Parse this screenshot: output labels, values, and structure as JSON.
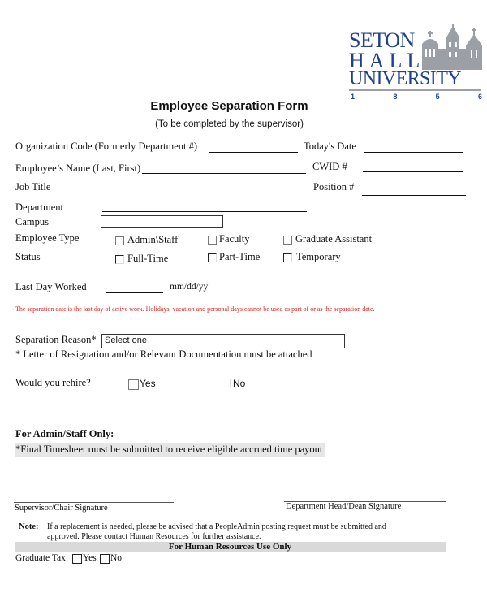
{
  "logo": {
    "line1": "SETON",
    "line2": "HALL",
    "line3": "UNIVERSITY",
    "years": [
      "1",
      "8",
      "5",
      "6"
    ],
    "color": "#1f3f8f"
  },
  "header": {
    "title": "Employee Separation Form",
    "subtitle": "(To be completed by the supervisor)"
  },
  "fields": {
    "org_code_label": "Organization Code (Formerly Department #)",
    "todays_date_label": "Today's Date",
    "employee_name_label": "Employee’s Name (Last, First)",
    "cwid_label": "CWID #",
    "job_title_label": "Job Title",
    "position_label": "Position #",
    "department_label": "Department",
    "campus_label": "Campus",
    "campus_value": "",
    "employee_type_label": "Employee Type",
    "status_label": "Status",
    "last_day_label": "Last Day Worked",
    "last_day_format": "mm/dd/yy"
  },
  "employee_type_options": [
    {
      "label": "Admin\\Staff",
      "checked": false
    },
    {
      "label": "Faculty",
      "checked": false
    },
    {
      "label": "Graduate Assistant",
      "checked": false
    }
  ],
  "status_options": [
    {
      "label": "Full-Time",
      "checked": false
    },
    {
      "label": "Part-Time",
      "checked": false
    },
    {
      "label": "Temporary",
      "checked": false
    }
  ],
  "separation_note": "The separation date is the last day of active work. Holidays, vacation and personal days cannot be used as part of or as the separation date.",
  "separation_reason": {
    "label": "Separation Reason*",
    "selected": "Select one",
    "footnote": "* Letter of Resignation and/or Relevant Documentation must be attached"
  },
  "rehire": {
    "label": "Would you rehire?",
    "yes": "Yes",
    "no": "No"
  },
  "admin_staff": {
    "heading": "For Admin/Staff Only:",
    "note": "*Final Timesheet must be submitted to receive eligible accrued time payout"
  },
  "signatures": {
    "supervisor": "Supervisor/Chair Signature",
    "dept_head": "Department Head/Dean Signature"
  },
  "note": {
    "label": "Note:",
    "text": "If a replacement is needed, please be advised that a PeopleAdmin posting request must be submitted and approved. Please contact Human Resources for further assistance."
  },
  "hr_section": {
    "heading": "For Human Resources Use Only",
    "graduate_tax_label": "Graduate Tax",
    "yes": "Yes",
    "no": "No"
  },
  "colors": {
    "warning_red": "#e0201a",
    "band_gray": "#e6e6e6"
  }
}
